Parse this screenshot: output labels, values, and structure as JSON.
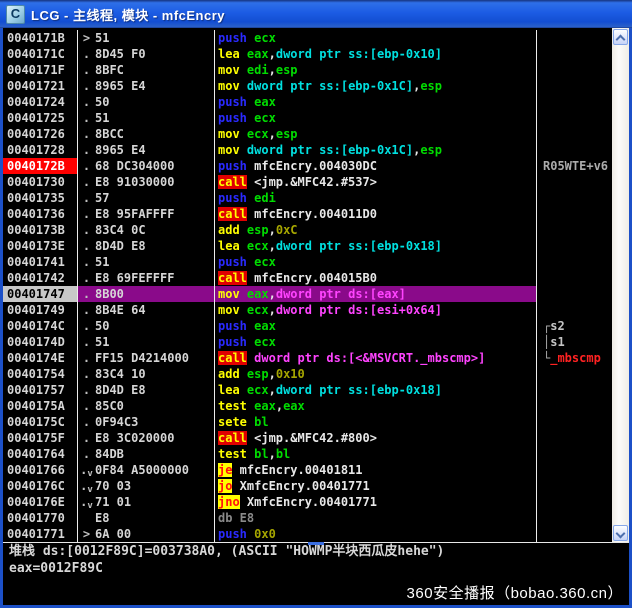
{
  "window": {
    "title": "LCG -  主线程, 模块 - mfcEncry",
    "icon_letter": "C"
  },
  "colors": {
    "breakpoint_bg": "#FF0000",
    "selected_row_bg": "#8A0A8A",
    "call_bg": "#E00000",
    "jcc_bg": "#FFFF00",
    "register": "#00DC00",
    "stack_ref": "#00E0E0",
    "memory_ref": "#FF44FF",
    "immediate": "#A6A600",
    "titlebar_blue": "#1C5CE4"
  },
  "disasm": {
    "rows": [
      {
        "addr": "0040171B",
        "marker": ">",
        "bytes": "51",
        "state": "",
        "ins": [
          [
            "push",
            "mp"
          ],
          [
            " ",
            "w"
          ],
          [
            "ecx",
            "r"
          ]
        ],
        "com": []
      },
      {
        "addr": "0040171C",
        "marker": ".",
        "bytes": "8D45 F0",
        "state": "",
        "ins": [
          [
            "lea",
            "mn"
          ],
          [
            " ",
            "w"
          ],
          [
            "eax",
            "r"
          ],
          [
            ",",
            "w"
          ],
          [
            "dword ptr ss:[ebp-0x10]",
            "s"
          ]
        ],
        "com": []
      },
      {
        "addr": "0040171F",
        "marker": ".",
        "bytes": "8BFC",
        "state": "",
        "ins": [
          [
            "mov",
            "mn"
          ],
          [
            " ",
            "w"
          ],
          [
            "edi",
            "r"
          ],
          [
            ",",
            "w"
          ],
          [
            "esp",
            "r"
          ]
        ],
        "com": []
      },
      {
        "addr": "00401721",
        "marker": ".",
        "bytes": "8965 E4",
        "state": "",
        "ins": [
          [
            "mov",
            "mn"
          ],
          [
            " ",
            "w"
          ],
          [
            "dword ptr ss:[ebp-0x1C]",
            "s"
          ],
          [
            ",",
            "w"
          ],
          [
            "esp",
            "r"
          ]
        ],
        "com": []
      },
      {
        "addr": "00401724",
        "marker": ".",
        "bytes": "50",
        "state": "",
        "ins": [
          [
            "push",
            "mp"
          ],
          [
            " ",
            "w"
          ],
          [
            "eax",
            "r"
          ]
        ],
        "com": []
      },
      {
        "addr": "00401725",
        "marker": ".",
        "bytes": "51",
        "state": "",
        "ins": [
          [
            "push",
            "mp"
          ],
          [
            " ",
            "w"
          ],
          [
            "ecx",
            "r"
          ]
        ],
        "com": []
      },
      {
        "addr": "00401726",
        "marker": ".",
        "bytes": "8BCC",
        "state": "",
        "ins": [
          [
            "mov",
            "mn"
          ],
          [
            " ",
            "w"
          ],
          [
            "ecx",
            "r"
          ],
          [
            ",",
            "w"
          ],
          [
            "esp",
            "r"
          ]
        ],
        "com": []
      },
      {
        "addr": "00401728",
        "marker": ".",
        "bytes": "8965 E4",
        "state": "",
        "ins": [
          [
            "mov",
            "mn"
          ],
          [
            " ",
            "w"
          ],
          [
            "dword ptr ss:[ebp-0x1C]",
            "s"
          ],
          [
            ",",
            "w"
          ],
          [
            "esp",
            "r"
          ]
        ],
        "com": []
      },
      {
        "addr": "0040172B",
        "marker": ".",
        "bytes": "68 DC304000",
        "state": "bp",
        "ins": [
          [
            "push",
            "mp"
          ],
          [
            " mfcEncry.004030DC",
            "w"
          ]
        ],
        "com": [
          [
            "R05WTE+v6",
            "g"
          ]
        ]
      },
      {
        "addr": "00401730",
        "marker": ".",
        "bytes": "E8 91030000",
        "state": "",
        "ins": [
          [
            "call",
            "mc"
          ],
          [
            " <jmp.&MFC42.#537>",
            "w"
          ]
        ],
        "com": []
      },
      {
        "addr": "00401735",
        "marker": ".",
        "bytes": "57",
        "state": "",
        "ins": [
          [
            "push",
            "mp"
          ],
          [
            " ",
            "w"
          ],
          [
            "edi",
            "r"
          ]
        ],
        "com": []
      },
      {
        "addr": "00401736",
        "marker": ".",
        "bytes": "E8 95FAFFFF",
        "state": "",
        "ins": [
          [
            "call",
            "mc"
          ],
          [
            " mfcEncry.004011D0",
            "w"
          ]
        ],
        "com": []
      },
      {
        "addr": "0040173B",
        "marker": ".",
        "bytes": "83C4 0C",
        "state": "",
        "ins": [
          [
            "add",
            "mn"
          ],
          [
            " ",
            "w"
          ],
          [
            "esp",
            "r"
          ],
          [
            ",",
            "w"
          ],
          [
            "0xC",
            "i"
          ]
        ],
        "com": []
      },
      {
        "addr": "0040173E",
        "marker": ".",
        "bytes": "8D4D E8",
        "state": "",
        "ins": [
          [
            "lea",
            "mn"
          ],
          [
            " ",
            "w"
          ],
          [
            "ecx",
            "r"
          ],
          [
            ",",
            "w"
          ],
          [
            "dword ptr ss:[ebp-0x18]",
            "s"
          ]
        ],
        "com": []
      },
      {
        "addr": "00401741",
        "marker": ".",
        "bytes": "51",
        "state": "",
        "ins": [
          [
            "push",
            "mp"
          ],
          [
            " ",
            "w"
          ],
          [
            "ecx",
            "r"
          ]
        ],
        "com": []
      },
      {
        "addr": "00401742",
        "marker": ".",
        "bytes": "E8 69FEFFFF",
        "state": "",
        "ins": [
          [
            "call",
            "mc"
          ],
          [
            " mfcEncry.004015B0",
            "w"
          ]
        ],
        "com": []
      },
      {
        "addr": "00401747",
        "marker": ".",
        "bytes": "8B00",
        "state": "sel",
        "ins": [
          [
            "mov",
            "mn"
          ],
          [
            " ",
            "w"
          ],
          [
            "eax",
            "r"
          ],
          [
            ",",
            "w"
          ],
          [
            "dword ptr ds:[eax]",
            "m"
          ]
        ],
        "com": []
      },
      {
        "addr": "00401749",
        "marker": ".",
        "bytes": "8B4E 64",
        "state": "",
        "ins": [
          [
            "mov",
            "mn"
          ],
          [
            " ",
            "w"
          ],
          [
            "ecx",
            "r"
          ],
          [
            ",",
            "w"
          ],
          [
            "dword ptr ds:[esi+0x64]",
            "m"
          ]
        ],
        "com": []
      },
      {
        "addr": "0040174C",
        "marker": ".",
        "bytes": "50",
        "state": "",
        "ins": [
          [
            "push",
            "mp"
          ],
          [
            " ",
            "w"
          ],
          [
            "eax",
            "r"
          ]
        ],
        "com": [
          [
            "┌",
            "g"
          ],
          [
            "s2",
            "g2"
          ]
        ]
      },
      {
        "addr": "0040174D",
        "marker": ".",
        "bytes": "51",
        "state": "",
        "ins": [
          [
            "push",
            "mp"
          ],
          [
            " ",
            "w"
          ],
          [
            "ecx",
            "r"
          ]
        ],
        "com": [
          [
            "│",
            "g"
          ],
          [
            "s1",
            "g2"
          ]
        ]
      },
      {
        "addr": "0040174E",
        "marker": ".",
        "bytes": "FF15 D4214000",
        "state": "",
        "ins": [
          [
            "call",
            "mc"
          ],
          [
            " ",
            "w"
          ],
          [
            "dword ptr ds:[<&MSVCRT._mbscmp>]",
            "m"
          ]
        ],
        "com": [
          [
            "└",
            "g"
          ],
          [
            "_mbscmp",
            "rd"
          ]
        ]
      },
      {
        "addr": "00401754",
        "marker": ".",
        "bytes": "83C4 10",
        "state": "",
        "ins": [
          [
            "add",
            "mn"
          ],
          [
            " ",
            "w"
          ],
          [
            "esp",
            "r"
          ],
          [
            ",",
            "w"
          ],
          [
            "0x10",
            "i"
          ]
        ],
        "com": []
      },
      {
        "addr": "00401757",
        "marker": ".",
        "bytes": "8D4D E8",
        "state": "",
        "ins": [
          [
            "lea",
            "mn"
          ],
          [
            " ",
            "w"
          ],
          [
            "ecx",
            "r"
          ],
          [
            ",",
            "w"
          ],
          [
            "dword ptr ss:[ebp-0x18]",
            "s"
          ]
        ],
        "com": []
      },
      {
        "addr": "0040175A",
        "marker": ".",
        "bytes": "85C0",
        "state": "",
        "ins": [
          [
            "test",
            "mn"
          ],
          [
            " ",
            "w"
          ],
          [
            "eax",
            "r"
          ],
          [
            ",",
            "w"
          ],
          [
            "eax",
            "r"
          ]
        ],
        "com": []
      },
      {
        "addr": "0040175C",
        "marker": ".",
        "bytes": "0F94C3",
        "state": "",
        "ins": [
          [
            "sete",
            "mn"
          ],
          [
            " ",
            "w"
          ],
          [
            "bl",
            "r"
          ]
        ],
        "com": []
      },
      {
        "addr": "0040175F",
        "marker": ".",
        "bytes": "E8 3C020000",
        "state": "",
        "ins": [
          [
            "call",
            "mc"
          ],
          [
            " <jmp.&MFC42.#800>",
            "w"
          ]
        ],
        "com": []
      },
      {
        "addr": "00401764",
        "marker": ".",
        "bytes": "84DB",
        "state": "",
        "ins": [
          [
            "test",
            "mn"
          ],
          [
            " ",
            "w"
          ],
          [
            "bl",
            "r"
          ],
          [
            ",",
            "w"
          ],
          [
            "bl",
            "r"
          ]
        ],
        "com": []
      },
      {
        "addr": "00401766",
        "marker": ".v",
        "bytes": "0F84 A5000000",
        "state": "",
        "ins": [
          [
            "je",
            "mj"
          ],
          [
            " mfcEncry.00401811",
            "w"
          ]
        ],
        "com": []
      },
      {
        "addr": "0040176C",
        "marker": ".v",
        "bytes": "70 03",
        "state": "",
        "ins": [
          [
            "jo",
            "mj"
          ],
          [
            " XmfcEncry.00401771",
            "w"
          ]
        ],
        "com": []
      },
      {
        "addr": "0040176E",
        "marker": ".v",
        "bytes": "71 01",
        "state": "",
        "ins": [
          [
            "jno",
            "mj"
          ],
          [
            " XmfcEncry.00401771",
            "w"
          ]
        ],
        "com": []
      },
      {
        "addr": "00401770",
        "marker": "",
        "bytes": "E8",
        "state": "",
        "ins": [
          [
            "db E8",
            "md"
          ]
        ],
        "com": []
      },
      {
        "addr": "00401771",
        "marker": ">",
        "bytes": "6A 00",
        "state": "",
        "ins": [
          [
            "push",
            "mp"
          ],
          [
            " ",
            "w"
          ],
          [
            "0x0",
            "i"
          ]
        ],
        "com": []
      }
    ]
  },
  "info": {
    "line1": "堆栈 ds:[0012F89C]=003738A0, (ASCII \"HOWMP半块西瓜皮hehe\")",
    "line2": "eax=0012F89C"
  },
  "watermark": "360安全播报（bobao.360.cn）"
}
